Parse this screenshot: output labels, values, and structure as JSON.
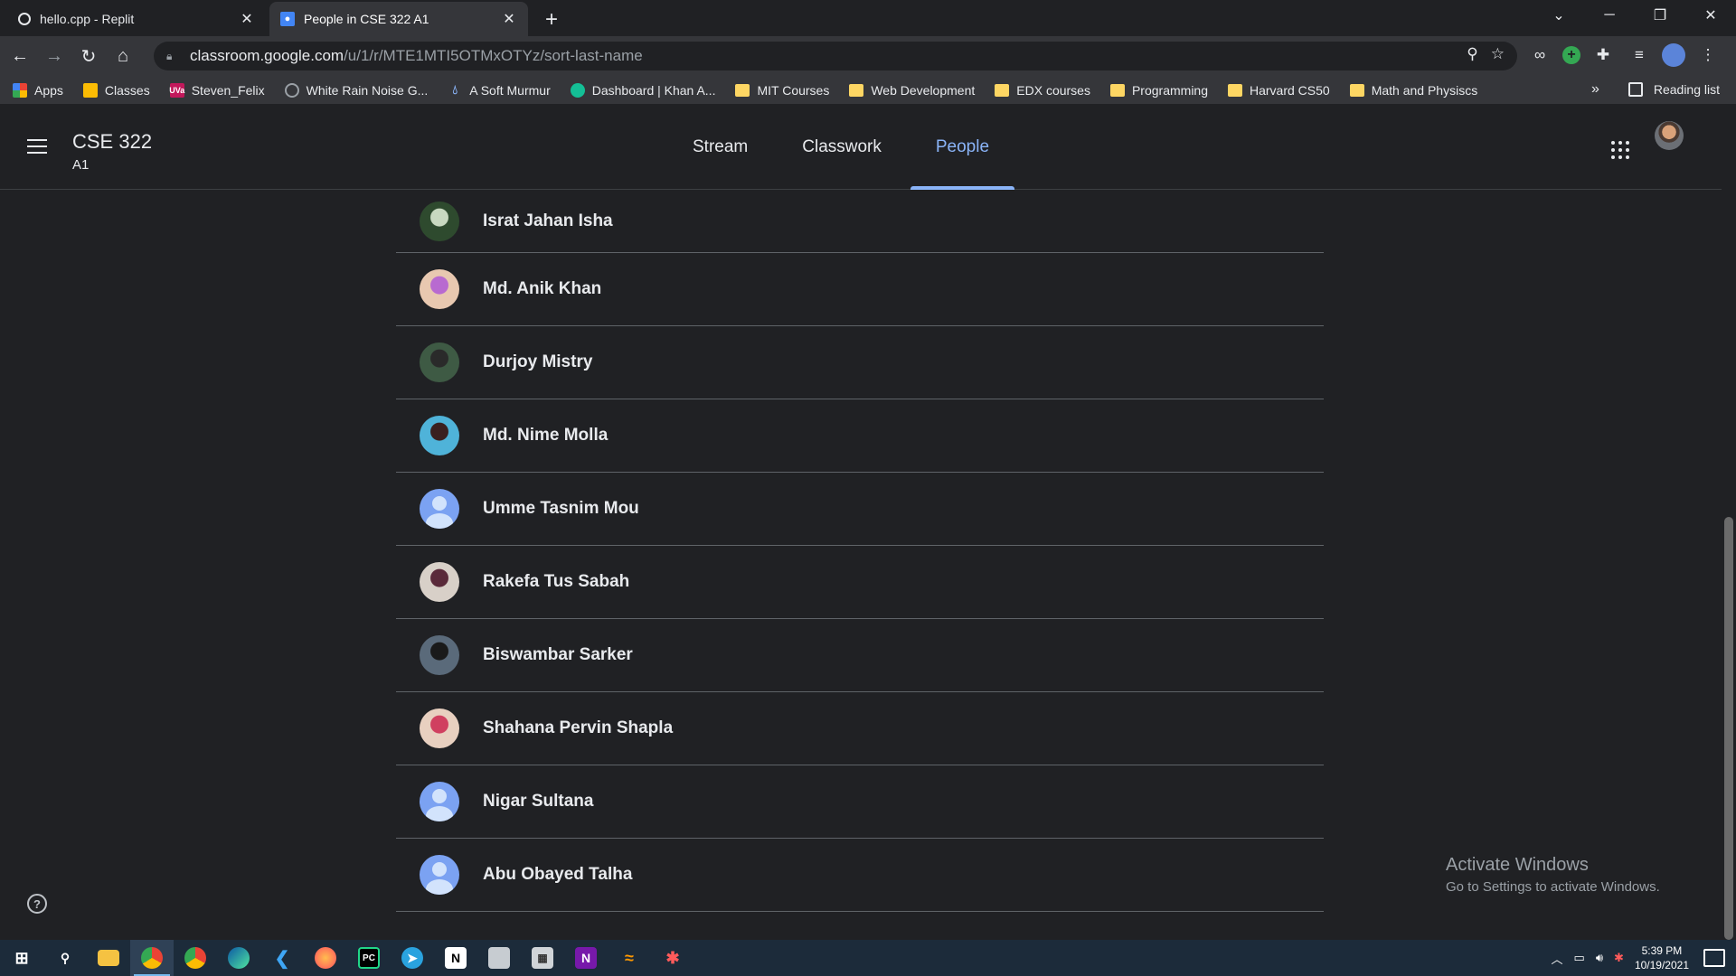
{
  "browser": {
    "tabs": [
      {
        "title": "hello.cpp - Replit",
        "active": false,
        "icon": "replit-icon"
      },
      {
        "title": "People in CSE 322 A1",
        "active": true,
        "icon": "classroom-icon"
      }
    ],
    "new_tab_symbol": "+",
    "url_host": "classroom.google.com",
    "url_path": "/u/1/r/MTE1MTI5OTMxOTYz/sort-last-name",
    "bookmarks": [
      {
        "label": "Apps",
        "icon": "apps-grid-icon",
        "color": "#ea4335"
      },
      {
        "label": "Classes",
        "icon": "classroom-icon",
        "color": "#fbbc04"
      },
      {
        "label": "Steven_Felix",
        "icon": "uva-icon",
        "color": "#c2185b"
      },
      {
        "label": "White Rain Noise G...",
        "icon": "noise-icon",
        "color": "#9aa0a6"
      },
      {
        "label": "A Soft Murmur",
        "icon": "drop-icon",
        "color": "#8ab4f8"
      },
      {
        "label": "Dashboard | Khan A...",
        "icon": "khan-icon",
        "color": "#14bf96"
      },
      {
        "label": "MIT Courses",
        "icon": "folder-icon",
        "color": "#fdd663"
      },
      {
        "label": "Web Development",
        "icon": "folder-icon",
        "color": "#fdd663"
      },
      {
        "label": "EDX courses",
        "icon": "folder-icon",
        "color": "#fdd663"
      },
      {
        "label": "Programming",
        "icon": "folder-icon",
        "color": "#fdd663"
      },
      {
        "label": "Harvard CS50",
        "icon": "folder-icon",
        "color": "#fdd663"
      },
      {
        "label": "Math and Physiscs",
        "icon": "folder-icon",
        "color": "#fdd663"
      }
    ],
    "bookmarks_more": "»",
    "reading_list": "Reading list"
  },
  "classroom": {
    "course_title": "CSE 322",
    "course_section": "A1",
    "tabs": [
      {
        "label": "Stream",
        "active": false
      },
      {
        "label": "Classwork",
        "active": false
      },
      {
        "label": "People",
        "active": true
      }
    ],
    "accent_color": "#8ab4f8"
  },
  "people": [
    {
      "name": "Israt Jahan Isha",
      "avatar": "photo",
      "colors": [
        "#2e4a2e",
        "#c8d8c0"
      ]
    },
    {
      "name": "Md. Anik Khan",
      "avatar": "photo",
      "colors": [
        "#e8c8b0",
        "#b86ad0"
      ]
    },
    {
      "name": "Durjoy Mistry",
      "avatar": "photo",
      "colors": [
        "#3e5a44",
        "#2a2a2a"
      ]
    },
    {
      "name": "Md. Nime Molla",
      "avatar": "photo",
      "colors": [
        "#4fb3d9",
        "#3a2020"
      ]
    },
    {
      "name": "Umme Tasnim Mou",
      "avatar": "default"
    },
    {
      "name": "Rakefa Tus Sabah",
      "avatar": "photo",
      "colors": [
        "#d8d0c8",
        "#5a2a3a"
      ]
    },
    {
      "name": "Biswambar Sarker",
      "avatar": "photo",
      "colors": [
        "#5a6a7a",
        "#1a1a1a"
      ]
    },
    {
      "name": "Shahana Pervin Shapla",
      "avatar": "photo",
      "colors": [
        "#e8d0c0",
        "#d04060"
      ]
    },
    {
      "name": "Nigar Sultana",
      "avatar": "default"
    },
    {
      "name": "Abu Obayed Talha",
      "avatar": "default"
    }
  ],
  "watermark": {
    "line1": "Activate Windows",
    "line2": "Go to Settings to activate Windows."
  },
  "help_symbol": "?",
  "taskbar": {
    "apps": [
      "windows-start-icon",
      "search-icon",
      "file-explorer-icon",
      "chrome-icon",
      "chrome-icon-2",
      "edge-icon",
      "vscode-icon",
      "firefox-icon",
      "pycharm-icon",
      "telegram-icon",
      "notion-icon",
      "app-icon",
      "calculator-icon",
      "onenote-icon",
      "sublime-icon",
      "settings-app-icon"
    ],
    "time": "5:39 PM",
    "date": "10/19/2021"
  }
}
